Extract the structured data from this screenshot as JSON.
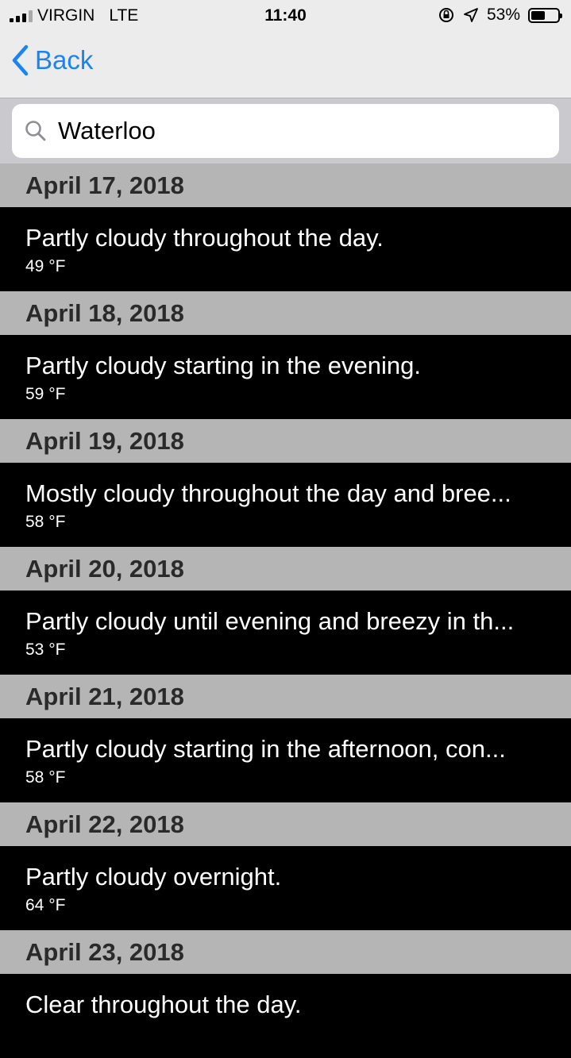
{
  "status": {
    "carrier": "VIRGIN",
    "network": "LTE",
    "time": "11:40",
    "battery": "53%",
    "battery_level": 0.53
  },
  "nav": {
    "back_label": "Back"
  },
  "search": {
    "value": "Waterloo",
    "placeholder": "Waterloo"
  },
  "forecast": [
    {
      "date": "April 17, 2018",
      "summary": "Partly cloudy throughout the day.",
      "temp": "49 °F"
    },
    {
      "date": "April 18, 2018",
      "summary": "Partly cloudy starting in the evening.",
      "temp": "59 °F"
    },
    {
      "date": "April 19, 2018",
      "summary": "Mostly cloudy throughout the day and bree...",
      "temp": "58 °F"
    },
    {
      "date": "April 20, 2018",
      "summary": "Partly cloudy until evening and breezy in th...",
      "temp": "53 °F"
    },
    {
      "date": "April 21, 2018",
      "summary": "Partly cloudy starting in the afternoon, con...",
      "temp": "58 °F"
    },
    {
      "date": "April 22, 2018",
      "summary": "Partly cloudy overnight.",
      "temp": "64 °F"
    },
    {
      "date": "April 23, 2018",
      "summary": "Clear throughout the day.",
      "temp": ""
    }
  ]
}
